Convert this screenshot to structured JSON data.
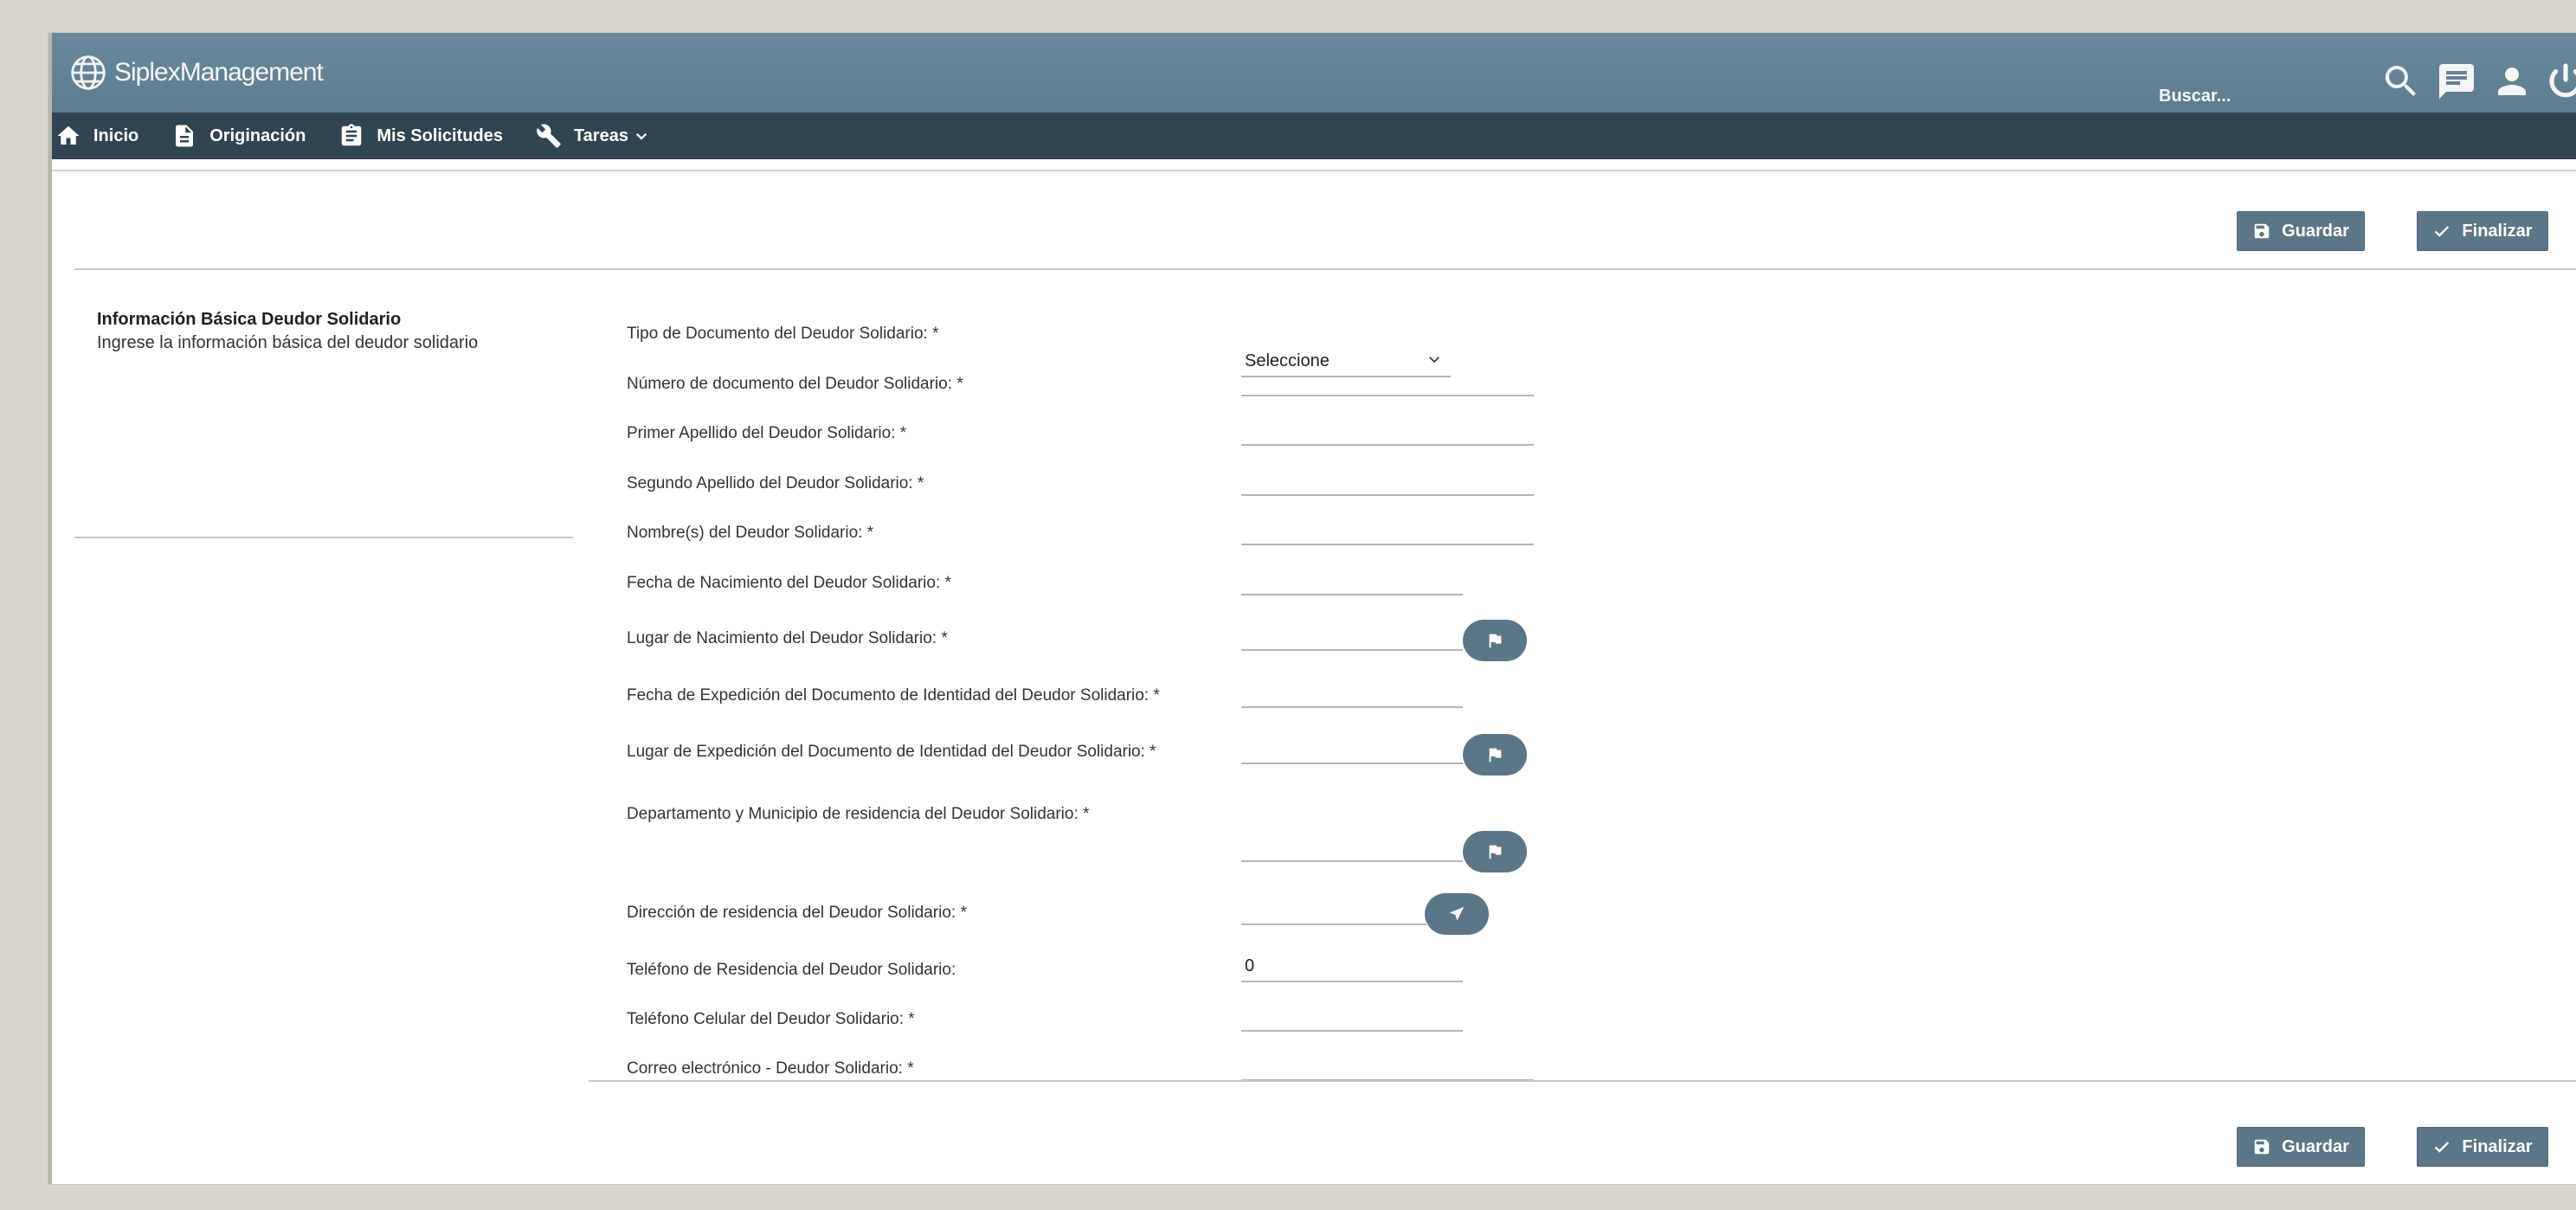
{
  "app": {
    "brand": "SiplexManagement"
  },
  "search": {
    "placeholder": "Buscar..."
  },
  "nav": [
    {
      "label": "Inicio",
      "icon": "home-icon"
    },
    {
      "label": "Originación",
      "icon": "document-icon"
    },
    {
      "label": "Mis Solicitudes",
      "icon": "clipboard-icon"
    },
    {
      "label": "Tareas",
      "icon": "wrench-icon",
      "dropdown": true
    }
  ],
  "actions": {
    "save": "Guardar",
    "finish": "Finalizar"
  },
  "section": {
    "title": "Información Básica Deudor Solidario",
    "subtitle": "Ingrese la información básica del deudor solidario"
  },
  "form": {
    "tipo_documento": {
      "label": "Tipo de Documento del Deudor Solidario: *",
      "value": "Seleccione"
    },
    "numero_documento": {
      "label": "Número de documento del Deudor Solidario: *",
      "value": ""
    },
    "primer_apellido": {
      "label": "Primer Apellido del Deudor Solidario: *",
      "value": ""
    },
    "segundo_apellido": {
      "label": "Segundo Apellido del Deudor Solidario: *",
      "value": ""
    },
    "nombres": {
      "label": "Nombre(s) del Deudor Solidario: *",
      "value": ""
    },
    "fecha_nacimiento": {
      "label": "Fecha de Nacimiento del Deudor Solidario: *",
      "value": ""
    },
    "lugar_nacimiento": {
      "label": "Lugar de Nacimiento del Deudor Solidario: *",
      "value": ""
    },
    "fecha_expedicion": {
      "label": "Fecha de Expedición del Documento de Identidad del Deudor Solidario: *",
      "value": ""
    },
    "lugar_expedicion": {
      "label": "Lugar de Expedición del Documento de Identidad del Deudor Solidario: *",
      "value": ""
    },
    "departamento_municipio": {
      "label": "Departamento y Municipio de residencia del Deudor Solidario: *",
      "value": ""
    },
    "direccion": {
      "label": "Dirección de residencia del Deudor Solidario: *",
      "value": ""
    },
    "telefono_residencia": {
      "label": "Teléfono de Residencia del Deudor Solidario:",
      "value": "0"
    },
    "telefono_celular": {
      "label": "Teléfono Celular del Deudor Solidario: *",
      "value": ""
    },
    "correo": {
      "label": "Correo electrónico - Deudor Solidario: *",
      "value": ""
    }
  },
  "colors": {
    "header": "#68899c",
    "nav": "#2f4552",
    "button": "#5b7687"
  }
}
